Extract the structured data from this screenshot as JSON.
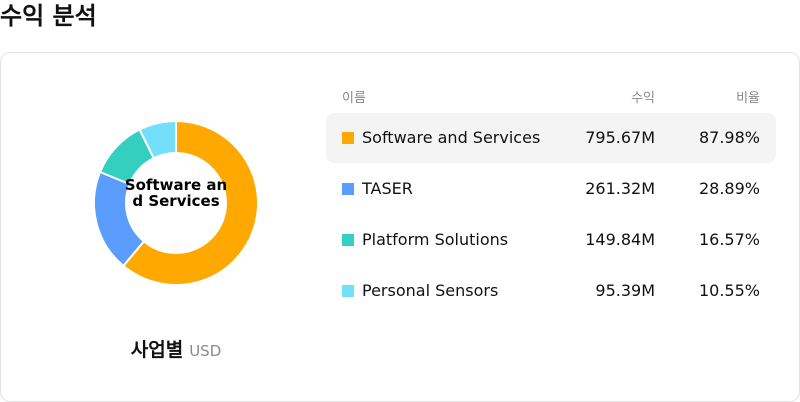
{
  "header": {
    "title": "수익 분석"
  },
  "donut": {
    "center_label": "Software and Services",
    "segment_title": "사업별",
    "unit": "USD"
  },
  "table": {
    "columns": {
      "name": "이름",
      "revenue": "수익",
      "share": "비율"
    },
    "rows": [
      {
        "name": "Software and Services",
        "revenue": "795.67M",
        "share": "87.98%",
        "color": "#ffa800",
        "highlighted": true
      },
      {
        "name": "TASER",
        "revenue": "261.32M",
        "share": "28.89%",
        "color": "#5b9cff",
        "highlighted": false
      },
      {
        "name": "Platform Solutions",
        "revenue": "149.84M",
        "share": "16.57%",
        "color": "#34cfbf",
        "highlighted": false
      },
      {
        "name": "Personal Sensors",
        "revenue": "95.39M",
        "share": "10.55%",
        "color": "#73dffb",
        "highlighted": false
      }
    ]
  },
  "chart_data": {
    "type": "pie",
    "categories": [
      "Software and Services",
      "TASER",
      "Platform Solutions",
      "Personal Sensors"
    ],
    "values": [
      795.67,
      261.32,
      149.84,
      95.39
    ],
    "colors": [
      "#ffa800",
      "#5b9cff",
      "#34cfbf",
      "#73dffb"
    ]
  }
}
